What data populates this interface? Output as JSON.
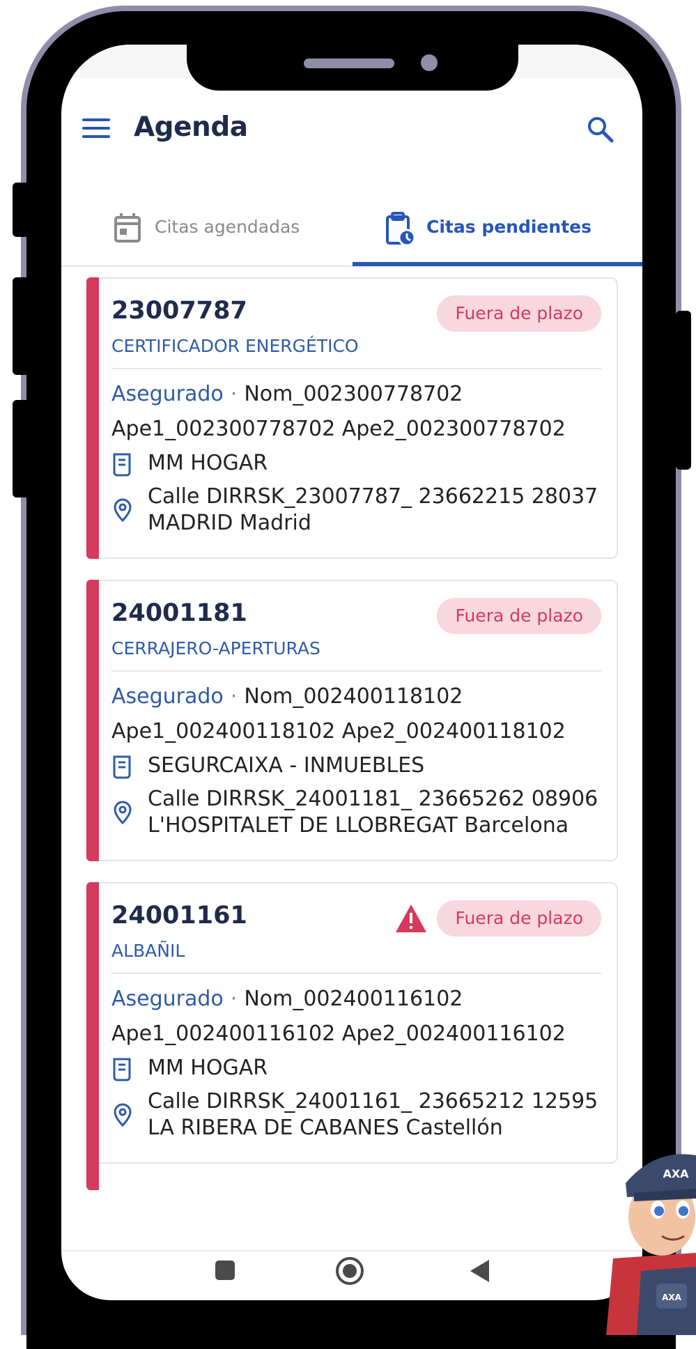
{
  "header": {
    "title": "Agenda",
    "menu_icon": "hamburger-menu-icon",
    "search_icon": "search-icon"
  },
  "tabs": [
    {
      "label": "Citas agendadas",
      "icon": "calendar-icon",
      "active": false
    },
    {
      "label": "Citas pendientes",
      "icon": "clipboard-clock-icon",
      "active": true
    }
  ],
  "cards": [
    {
      "number": "23007787",
      "specialty": "CERTIFICADOR ENERGÉTICO",
      "badge": "Fuera de plazo",
      "warning": false,
      "insured_label": "Asegurado",
      "separator": "·",
      "insured_name": "Nom_002300778702",
      "insured_surnames": "Ape1_002300778702 Ape2_002300778702",
      "company": "MM HOGAR",
      "address_line1": "Calle DIRRSK_23007787_ 23662215 28037",
      "address_line2": "MADRID Madrid"
    },
    {
      "number": "24001181",
      "specialty": "CERRAJERO-APERTURAS",
      "badge": "Fuera de plazo",
      "warning": false,
      "insured_label": "Asegurado",
      "separator": "·",
      "insured_name": "Nom_002400118102",
      "insured_surnames": "Ape1_002400118102 Ape2_002400118102",
      "company": "SEGURCAIXA - INMUEBLES",
      "address_line1": "Calle DIRRSK_24001181_ 23665262 08906",
      "address_line2": "L'HOSPITALET DE LLOBREGAT Barcelona"
    },
    {
      "number": "24001161",
      "specialty": "ALBAÑIL",
      "badge": "Fuera de plazo",
      "warning": true,
      "insured_label": "Asegurado",
      "separator": "·",
      "insured_name": "Nom_002400116102",
      "insured_surnames": "Ape1_002400116102 Ape2_002400116102",
      "company": "MM HOGAR",
      "address_line1": "Calle DIRRSK_24001161_ 23665212 12595",
      "address_line2": "LA RIBERA DE CABANES Castellón"
    }
  ],
  "colors": {
    "primary": "#2656b8",
    "title": "#1f2b4d",
    "accent_red": "#d63a5c",
    "badge_bg": "#f9d7df",
    "frame": "#8f8ea9"
  },
  "mascot": {
    "cap_text": "AXA",
    "bib_text": "AXA"
  }
}
